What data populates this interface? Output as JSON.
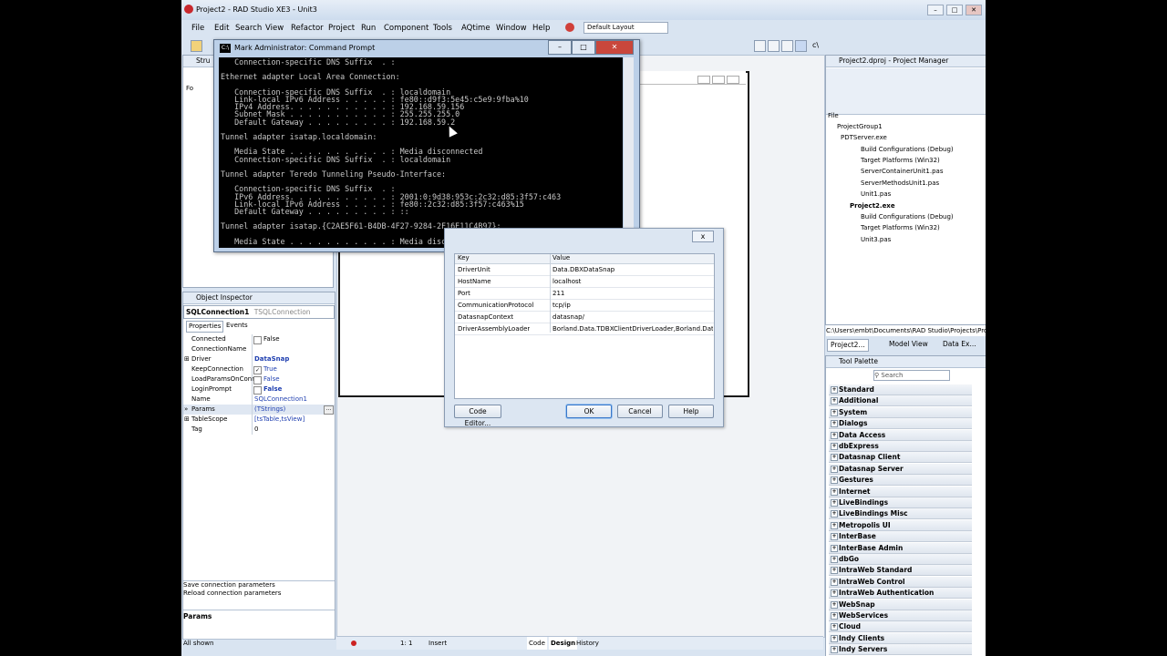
{
  "ide": {
    "title": "Project2 - RAD Studio XE3 - Unit3",
    "menu": [
      "File",
      "Edit",
      "Search",
      "View",
      "Refactor",
      "Project",
      "Run",
      "Component",
      "Tools",
      "AQtime",
      "Window",
      "Help"
    ],
    "layout": "Default Layout",
    "path_label": "c\\"
  },
  "structure_panel": {
    "title": "Stru",
    "root": "Fo"
  },
  "cmd": {
    "title": "Mark Administrator: Command Prompt",
    "lines": [
      "   Connection-specific DNS Suffix  . :",
      "",
      "Ethernet adapter Local Area Connection:",
      "",
      "   Connection-specific DNS Suffix  . : localdomain",
      "   Link-local IPv6 Address . . . . . : fe80::d9f3:5e45:c5e9:9fba%10",
      "   IPv4 Address. . . . . . . . . . . : 192.168.59.156",
      "   Subnet Mask . . . . . . . . . . . : 255.255.255.0",
      "   Default Gateway . . . . . . . . . : 192.168.59.2",
      "",
      "Tunnel adapter isatap.localdomain:",
      "",
      "   Media State . . . . . . . . . . . : Media disconnected",
      "   Connection-specific DNS Suffix  . : localdomain",
      "",
      "Tunnel adapter Teredo Tunneling Pseudo-Interface:",
      "",
      "   Connection-specific DNS Suffix  . :",
      "   IPv6 Address. . . . . . . . . . . : 2001:0:9d38:953c:2c32:d85:3f57:c463",
      "   Link-local IPv6 Address . . . . . : fe80::2c32:d85:3f57:c463%15",
      "   Default Gateway . . . . . . . . . : ::",
      "",
      "Tunnel adapter isatap.{C2AE5F61-B4DB-4F27-9284-2F16E11C4B97}:",
      "",
      "   Media State . . . . . . . . . . . : Media disconnected"
    ]
  },
  "dialog": {
    "columns": [
      "Key",
      "Value"
    ],
    "rows": [
      {
        "key": "DriverUnit",
        "value": "Data.DBXDataSnap"
      },
      {
        "key": "HostName",
        "value": "localhost"
      },
      {
        "key": "Port",
        "value": "211"
      },
      {
        "key": "CommunicationProtocol",
        "value": "tcp/ip"
      },
      {
        "key": "DatasnapContext",
        "value": "datasnap/"
      },
      {
        "key": "DriverAssemblyLoader",
        "value": "Borland.Data.TDBXClientDriverLoader,Borland.Data.D"
      }
    ],
    "code_editor": "Code Editor...",
    "ok": "OK",
    "cancel": "Cancel",
    "help": "Help",
    "close": "x"
  },
  "object_inspector": {
    "title": "Object Inspector",
    "component": "SQLConnection1",
    "component_type": "TSQLConnection",
    "tabs": [
      "Properties",
      "Events"
    ],
    "rows": [
      {
        "key": "Connected",
        "value": "False",
        "check": false
      },
      {
        "key": "ConnectionName",
        "value": ""
      },
      {
        "key": "Driver",
        "value": "DataSnap"
      },
      {
        "key": "KeepConnection",
        "value": "True",
        "check": true
      },
      {
        "key": "LoadParamsOnConn",
        "value": "False",
        "check": false
      },
      {
        "key": "LoginPrompt",
        "value": "False",
        "check": false
      },
      {
        "key": "Name",
        "value": "SQLConnection1"
      },
      {
        "key": "Params",
        "value": "(TStrings)"
      },
      {
        "key": "TableScope",
        "value": "[tsTable,tsView]"
      },
      {
        "key": "Tag",
        "value": "0"
      }
    ],
    "links": [
      "Save connection parameters",
      "Reload connection parameters"
    ],
    "description": "Params",
    "status": "All shown"
  },
  "project_manager": {
    "title": "Project2.dproj - Project Manager",
    "file_label": "File",
    "items": [
      {
        "label": "ProjectGroup1",
        "level": 0,
        "bold": false
      },
      {
        "label": "PDTServer.exe",
        "level": 1,
        "bold": false
      },
      {
        "label": "Build Configurations (Debug)",
        "level": 2,
        "bold": false
      },
      {
        "label": "Target Platforms (Win32)",
        "level": 2,
        "bold": false
      },
      {
        "label": "ServerContainerUnit1.pas",
        "level": 2,
        "bold": false
      },
      {
        "label": "ServerMethodsUnit1.pas",
        "level": 2,
        "bold": false
      },
      {
        "label": "Unit1.pas",
        "level": 2,
        "bold": false
      },
      {
        "label": "Project2.exe",
        "level": 1,
        "bold": true
      },
      {
        "label": "Build Configurations (Debug)",
        "level": 2,
        "bold": false
      },
      {
        "label": "Target Platforms (Win32)",
        "level": 2,
        "bold": false
      },
      {
        "label": "Unit3.pas",
        "level": 2,
        "bold": false
      }
    ],
    "path": "C:\\Users\\embt\\Documents\\RAD Studio\\Projects\\Proj",
    "tabs": [
      "Project2...",
      "Model View",
      "Data Ex..."
    ]
  },
  "tool_palette": {
    "title": "Tool Palette",
    "search_placeholder": "Search",
    "categories": [
      "Standard",
      "Additional",
      "System",
      "Dialogs",
      "Data Access",
      "dbExpress",
      "Datasnap Client",
      "Datasnap Server",
      "Gestures",
      "Internet",
      "LiveBindings",
      "LiveBindings Misc",
      "Metropolis UI",
      "InterBase",
      "InterBase Admin",
      "dbGo",
      "IntraWeb Standard",
      "IntraWeb Control",
      "IntraWeb Authentication",
      "WebSnap",
      "WebServices",
      "Cloud",
      "Indy Clients",
      "Indy Servers"
    ]
  },
  "statusbar": {
    "position": "1:   1",
    "mode": "Insert",
    "tabs": [
      "Code",
      "Design",
      "History"
    ]
  }
}
